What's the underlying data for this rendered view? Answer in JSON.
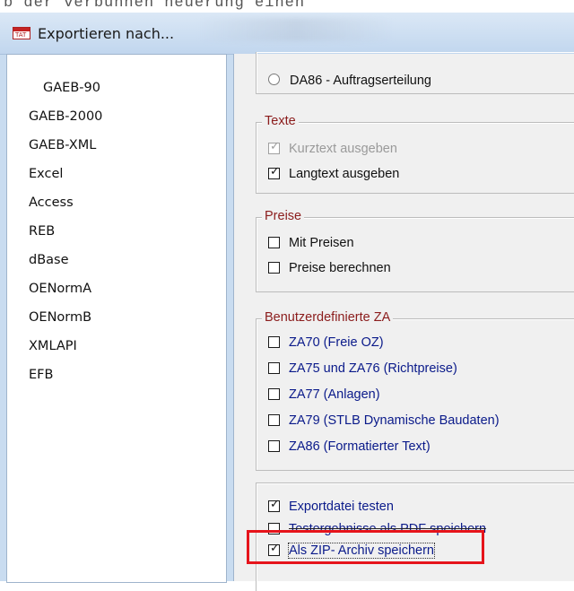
{
  "background_text": "b der verbunnen neuerung einen",
  "window": {
    "title": "Exportieren nach...",
    "app_icon": "tat-app-icon"
  },
  "formats": {
    "items": [
      "GAEB-90",
      "GAEB-2000",
      "GAEB-XML",
      "Excel",
      "Access",
      "REB",
      "dBase",
      "OENormA",
      "OENormB",
      "XMLAPI",
      "EFB"
    ]
  },
  "options": {
    "da86_radio": {
      "label": "DA86 - Auftragserteilung",
      "selected": false
    },
    "texte": {
      "title": "Texte",
      "kurztext": {
        "label": "Kurztext ausgeben",
        "checked": true,
        "enabled": false
      },
      "langtext": {
        "label": "Langtext ausgeben",
        "checked": true,
        "enabled": true
      }
    },
    "preise": {
      "title": "Preise",
      "mit_preisen": {
        "label": "Mit Preisen",
        "checked": false
      },
      "preise_berechnen": {
        "label": "Preise berechnen",
        "checked": false
      }
    },
    "benutzer": {
      "title": "Benutzerdefinierte ZA",
      "za70": {
        "label": "ZA70 (Freie OZ)",
        "checked": false
      },
      "za75": {
        "label": "ZA75 und ZA76 (Richtpreise)",
        "checked": false
      },
      "za77": {
        "label": "ZA77 (Anlagen)",
        "checked": false
      },
      "za79": {
        "label": "ZA79 (STLB Dynamische Baudaten)",
        "checked": false
      },
      "za86": {
        "label": "ZA86 (Formatierter Text)",
        "checked": false
      }
    },
    "export": {
      "testen": {
        "label": "Exportdatei testen",
        "checked": true
      },
      "pdf": {
        "label": "Testergebnisse als PDF speichern",
        "checked": false
      },
      "zip": {
        "label": "Als ZIP- Archiv speichern",
        "checked": true
      }
    }
  },
  "colors": {
    "highlight": "#e6141b",
    "group_title": "#8b1c1c",
    "za_label": "#0a1a8a"
  }
}
